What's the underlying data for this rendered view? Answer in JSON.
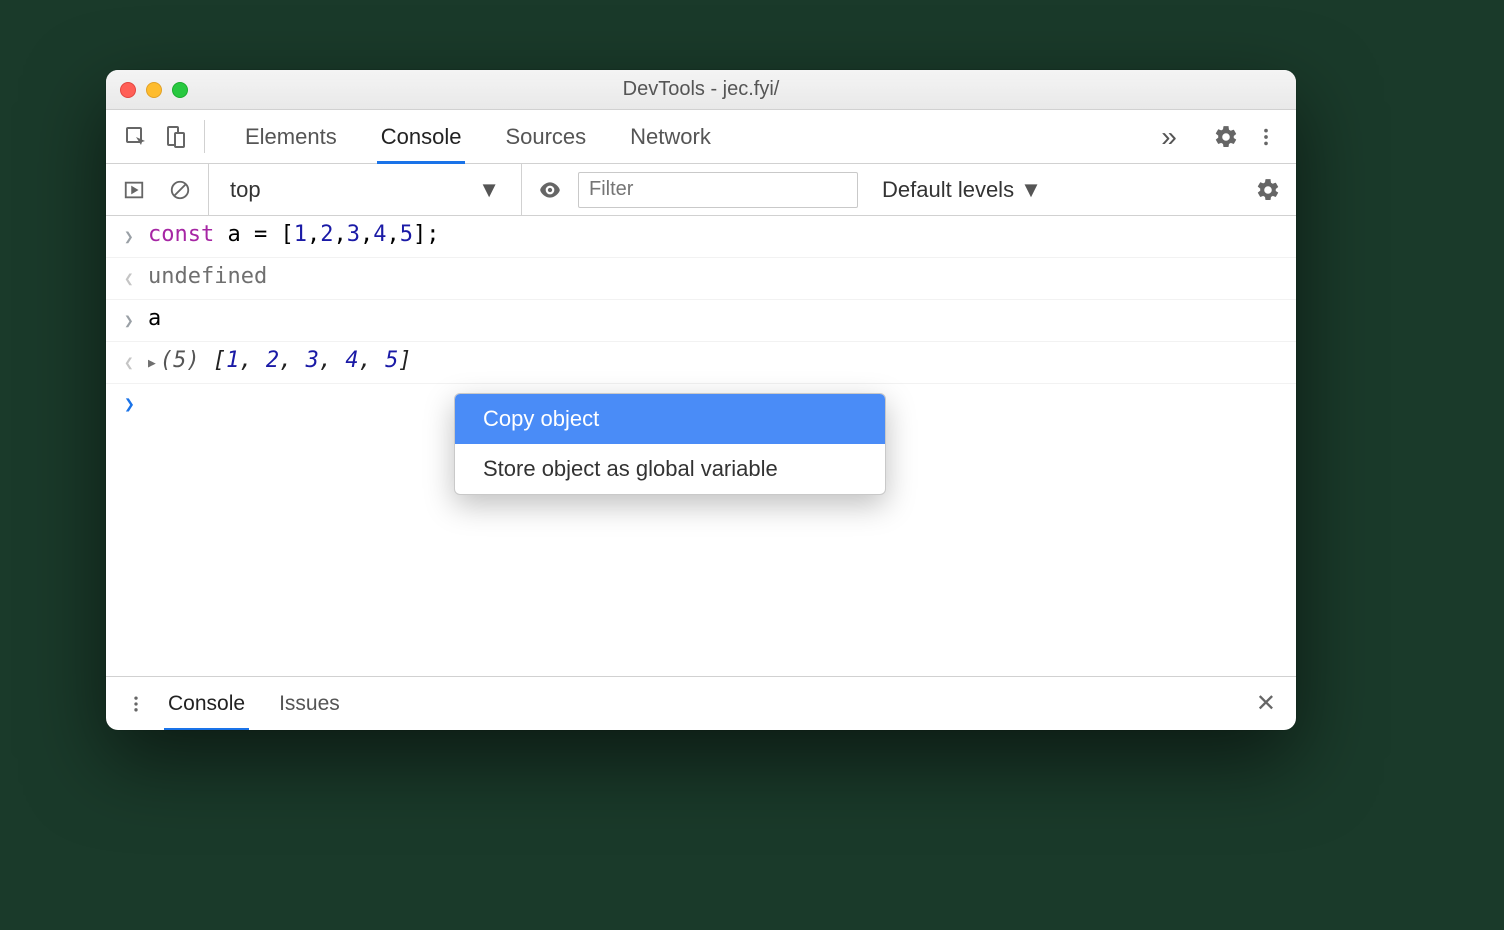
{
  "window": {
    "title": "DevTools - jec.fyi/"
  },
  "tabbar": {
    "tabs": [
      "Elements",
      "Console",
      "Sources",
      "Network"
    ],
    "active_index": 1,
    "overflow_glyph": "»"
  },
  "toolbar": {
    "context_label": "top",
    "filter_placeholder": "Filter",
    "levels_label": "Default levels"
  },
  "console": {
    "rows": [
      {
        "kind": "input",
        "tokens": [
          {
            "t": "const ",
            "c": "kw"
          },
          {
            "t": "a = [",
            "c": ""
          },
          {
            "t": "1",
            "c": "num"
          },
          {
            "t": ",",
            "c": ""
          },
          {
            "t": "2",
            "c": "num"
          },
          {
            "t": ",",
            "c": ""
          },
          {
            "t": "3",
            "c": "num"
          },
          {
            "t": ",",
            "c": ""
          },
          {
            "t": "4",
            "c": "num"
          },
          {
            "t": ",",
            "c": ""
          },
          {
            "t": "5",
            "c": "num"
          },
          {
            "t": "];",
            "c": ""
          }
        ]
      },
      {
        "kind": "output",
        "plain": "undefined"
      },
      {
        "kind": "input",
        "plain": "a"
      },
      {
        "kind": "output-obj",
        "count": "(5)",
        "values": [
          "1",
          "2",
          "3",
          "4",
          "5"
        ]
      },
      {
        "kind": "prompt"
      }
    ]
  },
  "context_menu": {
    "items": [
      {
        "label": "Copy object",
        "selected": true
      },
      {
        "label": "Store object as global variable",
        "selected": false
      }
    ]
  },
  "drawer": {
    "tabs": [
      "Console",
      "Issues"
    ],
    "active_index": 0
  }
}
